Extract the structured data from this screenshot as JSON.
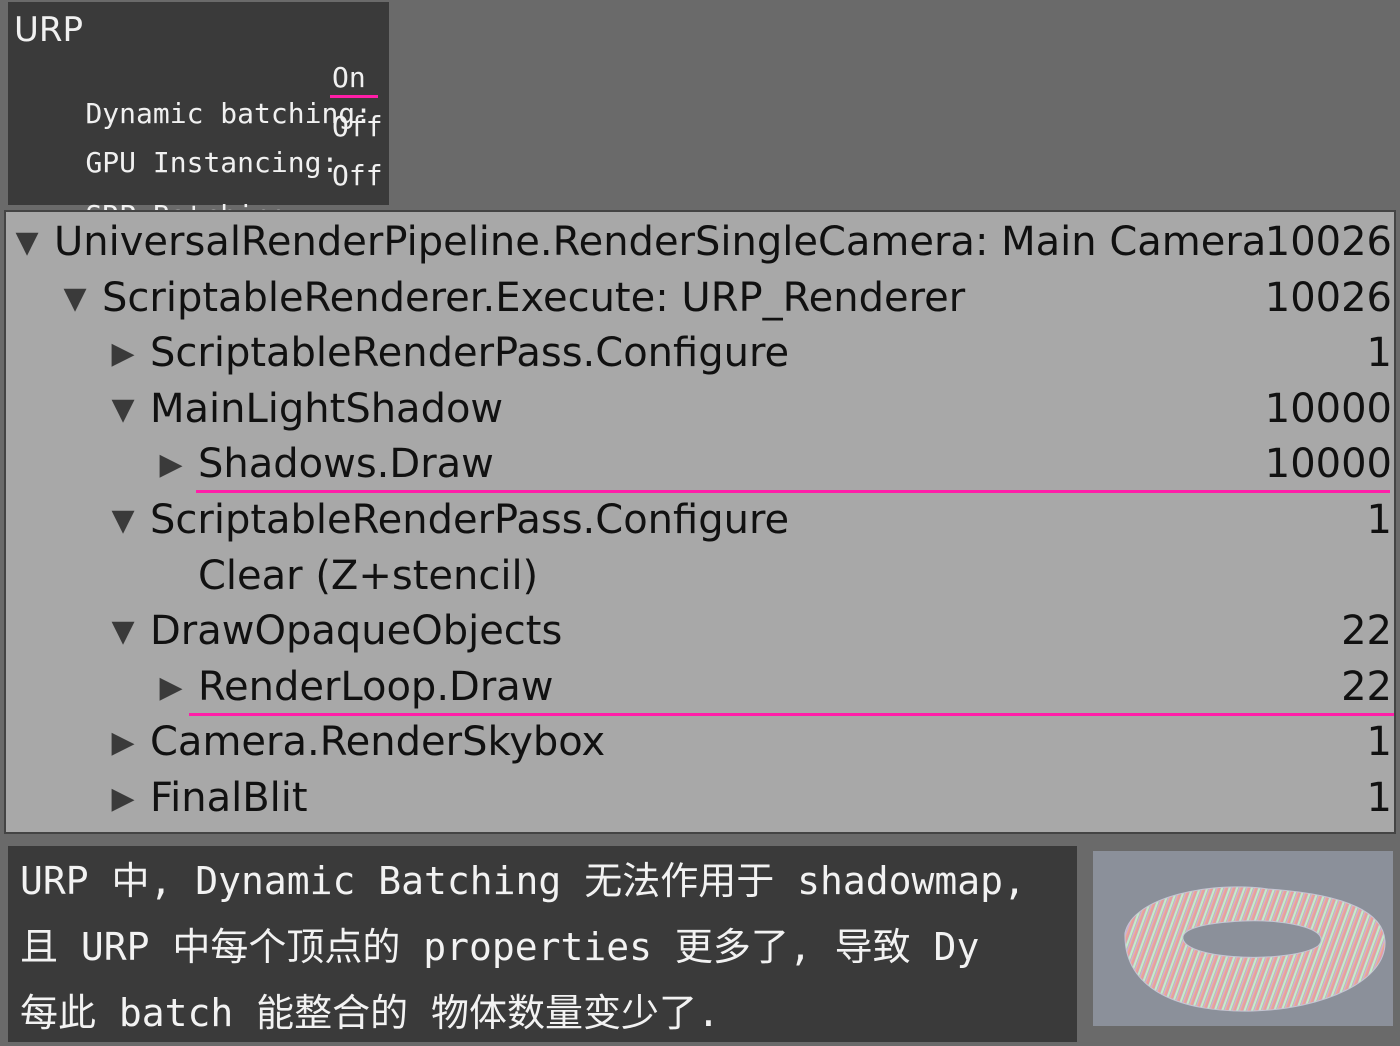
{
  "settings": {
    "title": "URP",
    "rows": [
      {
        "label": "Dynamic batching:",
        "value": "On"
      },
      {
        "label": "GPU Instancing:",
        "value": "Off"
      },
      {
        "label": "SRP Batching:",
        "value": "Off"
      }
    ],
    "highlight_color": "#ff1ea8"
  },
  "hierarchy": {
    "rows": [
      {
        "label": "UniversalRenderPipeline.RenderSingleCamera: Main Camera",
        "count": "10026",
        "expanded": true
      },
      {
        "label": "ScriptableRenderer.Execute: URP_Renderer",
        "count": "10026",
        "expanded": true
      },
      {
        "label": "ScriptableRenderPass.Configure",
        "count": "1",
        "expanded": false
      },
      {
        "label": "MainLightShadow",
        "count": "10000",
        "expanded": true
      },
      {
        "label": "Shadows.Draw",
        "count": "10000",
        "expanded": false
      },
      {
        "label": "ScriptableRenderPass.Configure",
        "count": "1",
        "expanded": true
      },
      {
        "label": "Clear (Z+stencil)",
        "count": "",
        "expanded": null
      },
      {
        "label": "DrawOpaqueObjects",
        "count": "22",
        "expanded": true
      },
      {
        "label": "RenderLoop.Draw",
        "count": "22",
        "expanded": false
      },
      {
        "label": "Camera.RenderSkybox",
        "count": "1",
        "expanded": false
      },
      {
        "label": "FinalBlit",
        "count": "1",
        "expanded": false
      }
    ],
    "triangle_expanded": "▼",
    "triangle_collapsed": "▶"
  },
  "caption": {
    "lines": [
      "URP 中, Dynamic Batching 无法作用于 shadowmap,",
      "且 URP 中每个顶点的 properties 更多了, 导致 Dy",
      "每此 batch 能整合的 物体数量变少了."
    ]
  },
  "thumbnail": {
    "icon": "rainbow-torus-mesh-image"
  }
}
